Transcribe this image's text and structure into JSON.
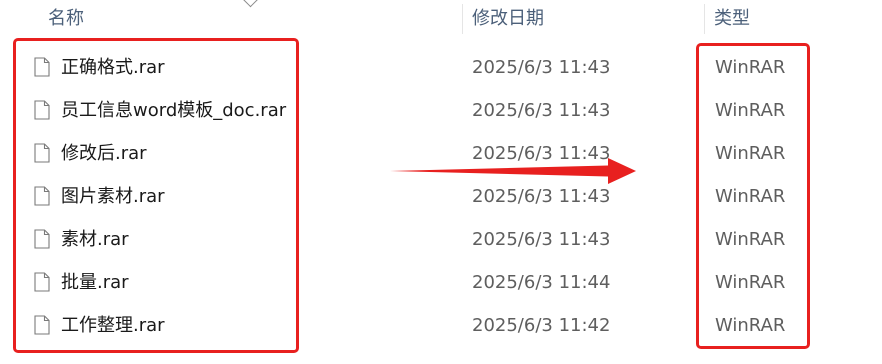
{
  "header": {
    "name": "名称",
    "modified": "修改日期",
    "type": "类型"
  },
  "files": [
    {
      "name": "正确格式.rar",
      "modified": "2025/6/3 11:43",
      "type": "WinRAR"
    },
    {
      "name": "员工信息word模板_doc.rar",
      "modified": "2025/6/3 11:43",
      "type": "WinRAR"
    },
    {
      "name": "修改后.rar",
      "modified": "2025/6/3 11:43",
      "type": "WinRAR"
    },
    {
      "name": "图片素材.rar",
      "modified": "2025/6/3 11:43",
      "type": "WinRAR"
    },
    {
      "name": "素材.rar",
      "modified": "2025/6/3 11:43",
      "type": "WinRAR"
    },
    {
      "name": "批量.rar",
      "modified": "2025/6/3 11:44",
      "type": "WinRAR"
    },
    {
      "name": "工作整理.rar",
      "modified": "2025/6/3 11:42",
      "type": "WinRAR"
    }
  ],
  "colors": {
    "highlight": "#e8201f",
    "header_text": "#4c607a"
  },
  "icons": {
    "file": "file-icon",
    "sort": "chevron-down-icon",
    "annotation": "arrow-right-icon"
  }
}
